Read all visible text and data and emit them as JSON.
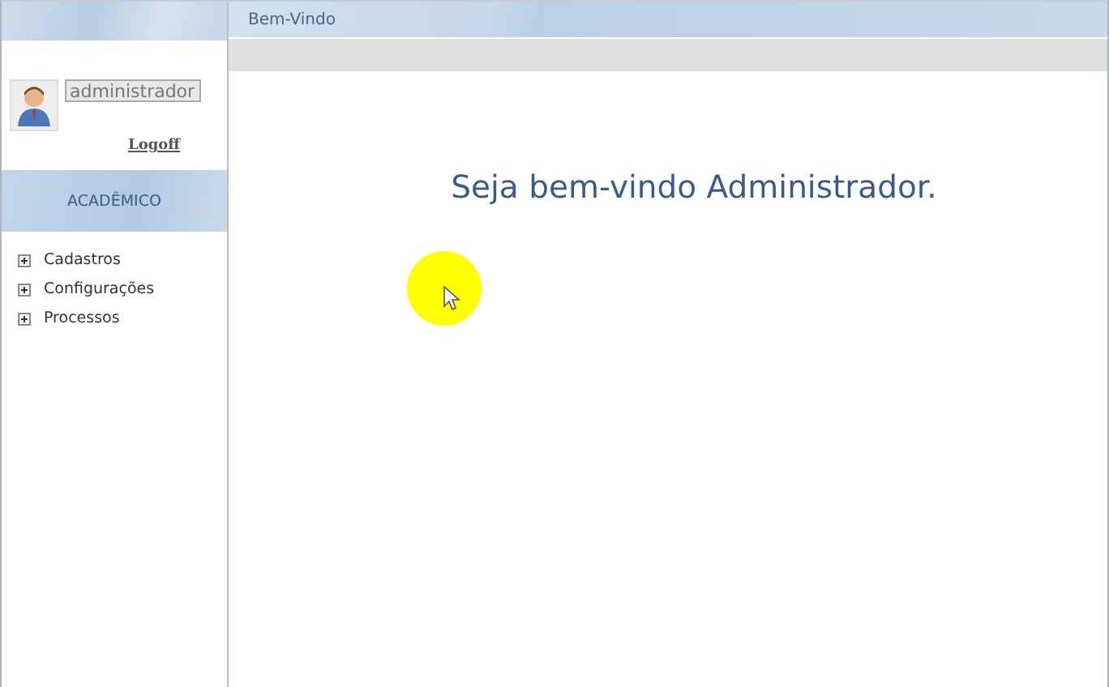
{
  "sidebar": {
    "user": {
      "value": "administrador",
      "logoff": "Logoff"
    },
    "section_title": "ACADÊMICO",
    "menu": [
      {
        "label": "Cadastros",
        "expanded": false
      },
      {
        "label": "Configurações",
        "expanded": false
      },
      {
        "label": "Processos",
        "expanded": false
      }
    ]
  },
  "main": {
    "tab_title": "Bem-Vindo",
    "welcome": "Seja bem-vindo Administrador."
  }
}
